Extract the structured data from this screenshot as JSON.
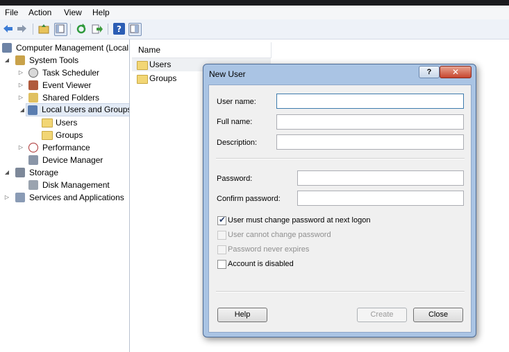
{
  "menu": {
    "items": [
      "File",
      "Action",
      "View",
      "Help"
    ]
  },
  "tree": {
    "root": "Computer Management (Local",
    "system_tools": "System Tools",
    "task_scheduler": "Task Scheduler",
    "event_viewer": "Event Viewer",
    "shared_folders": "Shared Folders",
    "local_users_groups": "Local Users and Groups",
    "users": "Users",
    "groups": "Groups",
    "performance": "Performance",
    "device_manager": "Device Manager",
    "storage": "Storage",
    "disk_management": "Disk Management",
    "services_apps": "Services and Applications"
  },
  "list": {
    "column_name": "Name",
    "items": [
      "Users",
      "Groups"
    ]
  },
  "dialog": {
    "title": "New User",
    "help_glyph": "?",
    "close_glyph": "✕",
    "user_name_label": "User name:",
    "user_name_value": "",
    "full_name_label": "Full name:",
    "full_name_value": "",
    "description_label": "Description:",
    "description_value": "",
    "password_label": "Password:",
    "password_value": "",
    "confirm_label": "Confirm password:",
    "confirm_value": "",
    "cb_must_change": {
      "label": "User must change password at next logon",
      "checked": true,
      "enabled": true
    },
    "cb_cannot_change": {
      "label": "User cannot change password",
      "checked": false,
      "enabled": false
    },
    "cb_never_expires": {
      "label": "Password never expires",
      "checked": false,
      "enabled": false
    },
    "cb_disabled": {
      "label": "Account is disabled",
      "checked": false,
      "enabled": true
    },
    "help_button": "Help",
    "create_button": "Create",
    "close_button": "Close"
  },
  "colors": {
    "dialog_frame": "#aac4e4",
    "selection": "#e3ebf6",
    "close_red": "#c7452e"
  },
  "icons": [
    "back-arrow-icon",
    "forward-arrow-icon",
    "up-folder-icon",
    "show-hide-tree-icon",
    "refresh-icon",
    "export-icon",
    "help-icon",
    "properties-icon"
  ]
}
